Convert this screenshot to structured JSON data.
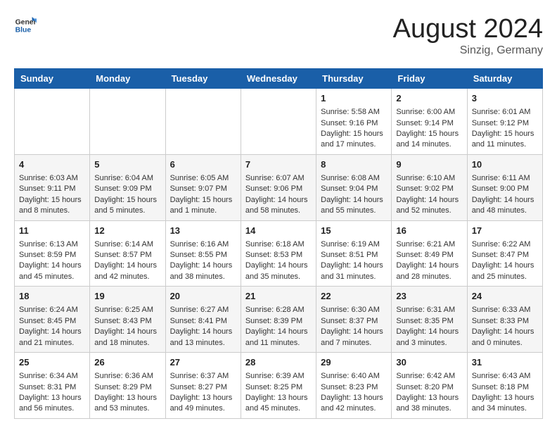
{
  "header": {
    "logo_general": "General",
    "logo_blue": "Blue",
    "month_title": "August 2024",
    "location": "Sinzig, Germany"
  },
  "weekdays": [
    "Sunday",
    "Monday",
    "Tuesday",
    "Wednesday",
    "Thursday",
    "Friday",
    "Saturday"
  ],
  "weeks": [
    [
      {
        "day": "",
        "sunrise": "",
        "sunset": "",
        "daylight": ""
      },
      {
        "day": "",
        "sunrise": "",
        "sunset": "",
        "daylight": ""
      },
      {
        "day": "",
        "sunrise": "",
        "sunset": "",
        "daylight": ""
      },
      {
        "day": "",
        "sunrise": "",
        "sunset": "",
        "daylight": ""
      },
      {
        "day": "1",
        "sunrise": "Sunrise: 5:58 AM",
        "sunset": "Sunset: 9:16 PM",
        "daylight": "Daylight: 15 hours and 17 minutes."
      },
      {
        "day": "2",
        "sunrise": "Sunrise: 6:00 AM",
        "sunset": "Sunset: 9:14 PM",
        "daylight": "Daylight: 15 hours and 14 minutes."
      },
      {
        "day": "3",
        "sunrise": "Sunrise: 6:01 AM",
        "sunset": "Sunset: 9:12 PM",
        "daylight": "Daylight: 15 hours and 11 minutes."
      }
    ],
    [
      {
        "day": "4",
        "sunrise": "Sunrise: 6:03 AM",
        "sunset": "Sunset: 9:11 PM",
        "daylight": "Daylight: 15 hours and 8 minutes."
      },
      {
        "day": "5",
        "sunrise": "Sunrise: 6:04 AM",
        "sunset": "Sunset: 9:09 PM",
        "daylight": "Daylight: 15 hours and 5 minutes."
      },
      {
        "day": "6",
        "sunrise": "Sunrise: 6:05 AM",
        "sunset": "Sunset: 9:07 PM",
        "daylight": "Daylight: 15 hours and 1 minute."
      },
      {
        "day": "7",
        "sunrise": "Sunrise: 6:07 AM",
        "sunset": "Sunset: 9:06 PM",
        "daylight": "Daylight: 14 hours and 58 minutes."
      },
      {
        "day": "8",
        "sunrise": "Sunrise: 6:08 AM",
        "sunset": "Sunset: 9:04 PM",
        "daylight": "Daylight: 14 hours and 55 minutes."
      },
      {
        "day": "9",
        "sunrise": "Sunrise: 6:10 AM",
        "sunset": "Sunset: 9:02 PM",
        "daylight": "Daylight: 14 hours and 52 minutes."
      },
      {
        "day": "10",
        "sunrise": "Sunrise: 6:11 AM",
        "sunset": "Sunset: 9:00 PM",
        "daylight": "Daylight: 14 hours and 48 minutes."
      }
    ],
    [
      {
        "day": "11",
        "sunrise": "Sunrise: 6:13 AM",
        "sunset": "Sunset: 8:59 PM",
        "daylight": "Daylight: 14 hours and 45 minutes."
      },
      {
        "day": "12",
        "sunrise": "Sunrise: 6:14 AM",
        "sunset": "Sunset: 8:57 PM",
        "daylight": "Daylight: 14 hours and 42 minutes."
      },
      {
        "day": "13",
        "sunrise": "Sunrise: 6:16 AM",
        "sunset": "Sunset: 8:55 PM",
        "daylight": "Daylight: 14 hours and 38 minutes."
      },
      {
        "day": "14",
        "sunrise": "Sunrise: 6:18 AM",
        "sunset": "Sunset: 8:53 PM",
        "daylight": "Daylight: 14 hours and 35 minutes."
      },
      {
        "day": "15",
        "sunrise": "Sunrise: 6:19 AM",
        "sunset": "Sunset: 8:51 PM",
        "daylight": "Daylight: 14 hours and 31 minutes."
      },
      {
        "day": "16",
        "sunrise": "Sunrise: 6:21 AM",
        "sunset": "Sunset: 8:49 PM",
        "daylight": "Daylight: 14 hours and 28 minutes."
      },
      {
        "day": "17",
        "sunrise": "Sunrise: 6:22 AM",
        "sunset": "Sunset: 8:47 PM",
        "daylight": "Daylight: 14 hours and 25 minutes."
      }
    ],
    [
      {
        "day": "18",
        "sunrise": "Sunrise: 6:24 AM",
        "sunset": "Sunset: 8:45 PM",
        "daylight": "Daylight: 14 hours and 21 minutes."
      },
      {
        "day": "19",
        "sunrise": "Sunrise: 6:25 AM",
        "sunset": "Sunset: 8:43 PM",
        "daylight": "Daylight: 14 hours and 18 minutes."
      },
      {
        "day": "20",
        "sunrise": "Sunrise: 6:27 AM",
        "sunset": "Sunset: 8:41 PM",
        "daylight": "Daylight: 14 hours and 13 minutes."
      },
      {
        "day": "21",
        "sunrise": "Sunrise: 6:28 AM",
        "sunset": "Sunset: 8:39 PM",
        "daylight": "Daylight: 14 hours and 11 minutes."
      },
      {
        "day": "22",
        "sunrise": "Sunrise: 6:30 AM",
        "sunset": "Sunset: 8:37 PM",
        "daylight": "Daylight: 14 hours and 7 minutes."
      },
      {
        "day": "23",
        "sunrise": "Sunrise: 6:31 AM",
        "sunset": "Sunset: 8:35 PM",
        "daylight": "Daylight: 14 hours and 3 minutes."
      },
      {
        "day": "24",
        "sunrise": "Sunrise: 6:33 AM",
        "sunset": "Sunset: 8:33 PM",
        "daylight": "Daylight: 14 hours and 0 minutes."
      }
    ],
    [
      {
        "day": "25",
        "sunrise": "Sunrise: 6:34 AM",
        "sunset": "Sunset: 8:31 PM",
        "daylight": "Daylight: 13 hours and 56 minutes."
      },
      {
        "day": "26",
        "sunrise": "Sunrise: 6:36 AM",
        "sunset": "Sunset: 8:29 PM",
        "daylight": "Daylight: 13 hours and 53 minutes."
      },
      {
        "day": "27",
        "sunrise": "Sunrise: 6:37 AM",
        "sunset": "Sunset: 8:27 PM",
        "daylight": "Daylight: 13 hours and 49 minutes."
      },
      {
        "day": "28",
        "sunrise": "Sunrise: 6:39 AM",
        "sunset": "Sunset: 8:25 PM",
        "daylight": "Daylight: 13 hours and 45 minutes."
      },
      {
        "day": "29",
        "sunrise": "Sunrise: 6:40 AM",
        "sunset": "Sunset: 8:23 PM",
        "daylight": "Daylight: 13 hours and 42 minutes."
      },
      {
        "day": "30",
        "sunrise": "Sunrise: 6:42 AM",
        "sunset": "Sunset: 8:20 PM",
        "daylight": "Daylight: 13 hours and 38 minutes."
      },
      {
        "day": "31",
        "sunrise": "Sunrise: 6:43 AM",
        "sunset": "Sunset: 8:18 PM",
        "daylight": "Daylight: 13 hours and 34 minutes."
      }
    ]
  ]
}
